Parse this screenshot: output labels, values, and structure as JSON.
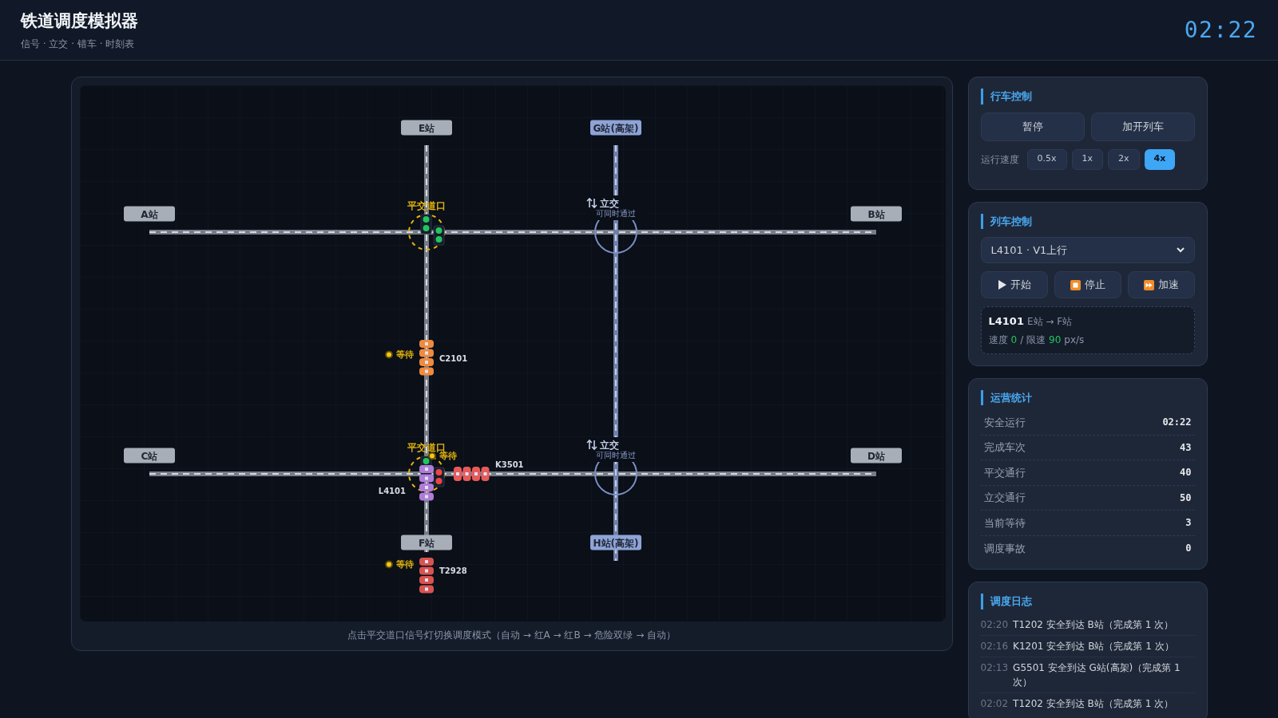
{
  "header": {
    "title": "铁道调度模拟器",
    "subtitle": "信号 · 立交 · 错车 · 时刻表",
    "clock": "02:22"
  },
  "map": {
    "stations": [
      {
        "label": "E站",
        "kind": "ground"
      },
      {
        "label": "G站(高架)",
        "kind": "elevated"
      },
      {
        "label": "A站",
        "kind": "ground"
      },
      {
        "label": "B站",
        "kind": "ground"
      },
      {
        "label": "C站",
        "kind": "ground"
      },
      {
        "label": "D站",
        "kind": "ground"
      },
      {
        "label": "F站",
        "kind": "ground"
      },
      {
        "label": "H站(高架)",
        "kind": "elevated"
      }
    ],
    "junctions": [
      {
        "kind": "level",
        "label": "平交道口",
        "signals": [
          {
            "color": "#22c55e"
          },
          {
            "color": "#22c55e"
          }
        ]
      },
      {
        "kind": "overpass",
        "label": "立交",
        "note": "可同时通过"
      },
      {
        "kind": "level",
        "label": "平交道口",
        "signals": [
          {
            "color": "#22c55e"
          },
          {
            "color": "#ef4444"
          }
        ]
      },
      {
        "kind": "overpass",
        "label": "立交",
        "note": "可同时通过"
      }
    ],
    "trains": [
      {
        "id": "C2101",
        "color": "#f08a3c",
        "status": "等待"
      },
      {
        "id": "K3501",
        "color": "#e85a5a",
        "status": "等待"
      },
      {
        "id": "L4101",
        "color": "#b07cd8"
      },
      {
        "id": "T2928",
        "color": "#d9534f",
        "status": "等待"
      }
    ],
    "hint": "点击平交道口信号灯切换调度模式（自动 → 红A → 红B → 危险双绿 → 自动）"
  },
  "drive_control": {
    "title": "行车控制",
    "buttons": [
      "暂停",
      "加开列车"
    ],
    "speed_label": "运行速度",
    "speeds": [
      {
        "label": "0.5x",
        "selected": false
      },
      {
        "label": "1x",
        "selected": false
      },
      {
        "label": "2x",
        "selected": false
      },
      {
        "label": "4x",
        "selected": true
      }
    ]
  },
  "train_control": {
    "title": "列车控制",
    "selected_train": "L4101 · V1上行",
    "buttons": [
      {
        "label": "开始"
      },
      {
        "label": "停止"
      },
      {
        "label": "加速"
      }
    ],
    "info": {
      "train": "L4101",
      "route": "E站 → F站",
      "speed_label": "速度",
      "speed": "0",
      "limit_label": "/ 限速",
      "limit": "90",
      "unit": "px/s"
    }
  },
  "stats": {
    "title": "运营统计",
    "rows": [
      {
        "label": "安全运行",
        "value": "02:22"
      },
      {
        "label": "完成车次",
        "value": "43"
      },
      {
        "label": "平交通行",
        "value": "40"
      },
      {
        "label": "立交通行",
        "value": "50"
      },
      {
        "label": "当前等待",
        "value": "3"
      },
      {
        "label": "调度事故",
        "value": "0"
      }
    ]
  },
  "log": {
    "title": "调度日志",
    "entries": [
      {
        "time": "02:20",
        "text": "T1202 安全到达 B站（完成第 1 次）"
      },
      {
        "time": "02:16",
        "text": "K1201 安全到达 B站（完成第 1 次）"
      },
      {
        "time": "02:13",
        "text": "G5501 安全到达 G站(高架)（完成第 1 次）"
      },
      {
        "time": "02:02",
        "text": "T1202 安全到达 B站（完成第 1 次）"
      }
    ]
  }
}
